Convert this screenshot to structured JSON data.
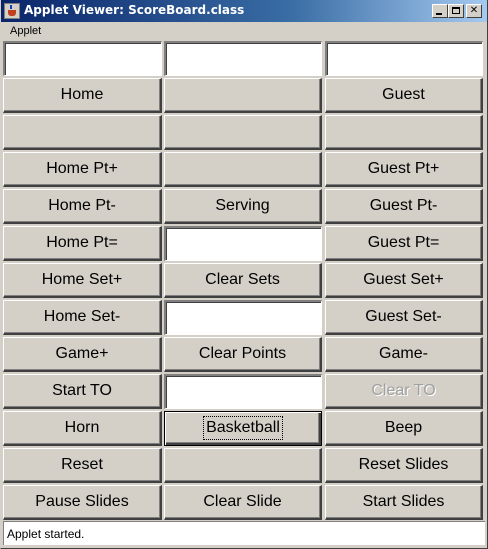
{
  "window": {
    "title": "Applet Viewer: ScoreBoard.class",
    "icon": "java-cup-icon",
    "controls": [
      "minimize",
      "maximize",
      "close"
    ],
    "close_glyph": "✕"
  },
  "menubar": {
    "items": [
      "Applet"
    ]
  },
  "grid": {
    "columns": 3,
    "cells": [
      {
        "kind": "field",
        "name": "home-score-field",
        "value": ""
      },
      {
        "kind": "field",
        "name": "serving-field",
        "value": ""
      },
      {
        "kind": "field",
        "name": "guest-score-field",
        "value": ""
      },
      {
        "kind": "button",
        "name": "home-button",
        "label": "Home"
      },
      {
        "kind": "button",
        "name": "blank-button-r2c2",
        "label": ""
      },
      {
        "kind": "button",
        "name": "guest-button",
        "label": "Guest"
      },
      {
        "kind": "button",
        "name": "blank-button-r3c1",
        "label": ""
      },
      {
        "kind": "button",
        "name": "blank-button-r3c2",
        "label": ""
      },
      {
        "kind": "button",
        "name": "blank-button-r3c3",
        "label": ""
      },
      {
        "kind": "button",
        "name": "home-pt-plus-button",
        "label": "Home Pt+"
      },
      {
        "kind": "button",
        "name": "blank-button-r4c2",
        "label": ""
      },
      {
        "kind": "button",
        "name": "guest-pt-plus-button",
        "label": "Guest Pt+"
      },
      {
        "kind": "button",
        "name": "home-pt-minus-button",
        "label": "Home Pt-"
      },
      {
        "kind": "button",
        "name": "serving-button",
        "label": "Serving"
      },
      {
        "kind": "button",
        "name": "guest-pt-minus-button",
        "label": "Guest Pt-"
      },
      {
        "kind": "button",
        "name": "home-pt-equals-button",
        "label": "Home Pt="
      },
      {
        "kind": "field",
        "name": "points-field",
        "value": ""
      },
      {
        "kind": "button",
        "name": "guest-pt-equals-button",
        "label": "Guest Pt="
      },
      {
        "kind": "button",
        "name": "home-set-plus-button",
        "label": "Home Set+"
      },
      {
        "kind": "button",
        "name": "clear-sets-button",
        "label": "Clear Sets"
      },
      {
        "kind": "button",
        "name": "guest-set-plus-button",
        "label": "Guest Set+"
      },
      {
        "kind": "button",
        "name": "home-set-minus-button",
        "label": "Home Set-"
      },
      {
        "kind": "field",
        "name": "sets-field",
        "value": ""
      },
      {
        "kind": "button",
        "name": "guest-set-minus-button",
        "label": "Guest Set-"
      },
      {
        "kind": "button",
        "name": "game-plus-button",
        "label": "Game+"
      },
      {
        "kind": "button",
        "name": "clear-points-button",
        "label": "Clear Points"
      },
      {
        "kind": "button",
        "name": "game-minus-button",
        "label": "Game-"
      },
      {
        "kind": "button",
        "name": "start-to-button",
        "label": "Start TO"
      },
      {
        "kind": "field",
        "name": "timeout-field",
        "value": ""
      },
      {
        "kind": "button",
        "name": "clear-to-button",
        "label": "Clear TO",
        "disabled": true
      },
      {
        "kind": "button",
        "name": "horn-button",
        "label": "Horn"
      },
      {
        "kind": "button",
        "name": "basketball-button",
        "label": "Basketball",
        "focused": true
      },
      {
        "kind": "button",
        "name": "beep-button",
        "label": "Beep"
      },
      {
        "kind": "button",
        "name": "reset-button",
        "label": "Reset"
      },
      {
        "kind": "button",
        "name": "blank-button-r12c2",
        "label": ""
      },
      {
        "kind": "button",
        "name": "reset-slides-button",
        "label": "Reset Slides"
      },
      {
        "kind": "button",
        "name": "pause-slides-button",
        "label": "Pause Slides"
      },
      {
        "kind": "button",
        "name": "clear-slide-button",
        "label": "Clear Slide"
      },
      {
        "kind": "button",
        "name": "start-slides-button",
        "label": "Start Slides"
      }
    ]
  },
  "status": {
    "text": "Applet started."
  }
}
